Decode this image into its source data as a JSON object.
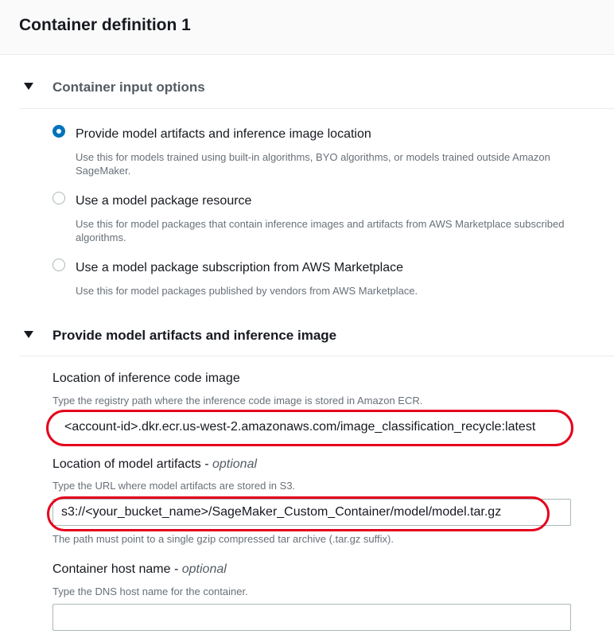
{
  "header": {
    "title": "Container definition 1"
  },
  "input_options": {
    "title": "Container input options",
    "options": [
      {
        "label": "Provide model artifacts and inference image location",
        "description": "Use this for models trained using built-in algorithms, BYO algorithms, or models trained outside Amazon SageMaker.",
        "checked": true
      },
      {
        "label": "Use a model package resource",
        "description": "Use this for model packages that contain inference images and artifacts from AWS Marketplace subscribed algorithms.",
        "checked": false
      },
      {
        "label": "Use a model package subscription from AWS Marketplace",
        "description": "Use this for model packages published by vendors from AWS Marketplace.",
        "checked": false
      }
    ]
  },
  "artifacts": {
    "title": "Provide model artifacts and inference image",
    "inference_image": {
      "label": "Location of inference code image",
      "description": "Type the registry path where the inference code image is stored in Amazon ECR.",
      "value": "<account-id>.dkr.ecr.us-west-2.amazonaws.com/image_classification_recycle:latest"
    },
    "model_artifacts": {
      "label": "Location of model artifacts - ",
      "optional": "optional",
      "description": "Type the URL where model artifacts are stored in S3.",
      "value": "s3://<your_bucket_name>/SageMaker_Custom_Container/model/model.tar.gz",
      "hint": "The path must point to a single gzip compressed tar archive (.tar.gz suffix)."
    },
    "host_name": {
      "label": "Container host name - ",
      "optional": "optional",
      "description": "Type the DNS host name for the container.",
      "value": ""
    }
  },
  "colors": {
    "accent": "#0073bb",
    "highlight": "#e4001b"
  }
}
